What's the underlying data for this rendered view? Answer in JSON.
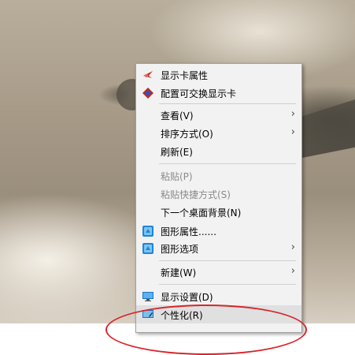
{
  "context_menu": {
    "items": [
      {
        "label": "显示卡属性",
        "icon": "intel-graphics-icon",
        "enabled": true
      },
      {
        "label": "配置可交换显示卡",
        "icon": "amd-switchable-icon",
        "enabled": true
      },
      {
        "label": "查看(V)",
        "has_submenu": true,
        "enabled": true
      },
      {
        "label": "排序方式(O)",
        "has_submenu": true,
        "enabled": true
      },
      {
        "label": "刷新(E)",
        "enabled": true
      },
      {
        "label": "粘贴(P)",
        "enabled": false
      },
      {
        "label": "粘贴快捷方式(S)",
        "enabled": false
      },
      {
        "label": "下一个桌面背景(N)",
        "enabled": true
      },
      {
        "label": "图形属性......",
        "icon": "graphics-properties-icon",
        "enabled": true
      },
      {
        "label": "图形选项",
        "icon": "graphics-options-icon",
        "has_submenu": true,
        "enabled": true
      },
      {
        "label": "新建(W)",
        "has_submenu": true,
        "enabled": true
      },
      {
        "label": "显示设置(D)",
        "icon": "display-settings-icon",
        "enabled": true
      },
      {
        "label": "个性化(R)",
        "icon": "personalize-icon",
        "enabled": true,
        "highlighted": true
      }
    ],
    "submenu_arrow": "›"
  },
  "annotation": {
    "shape": "ellipse",
    "color": "#d7262b",
    "target": "个性化(R)"
  }
}
